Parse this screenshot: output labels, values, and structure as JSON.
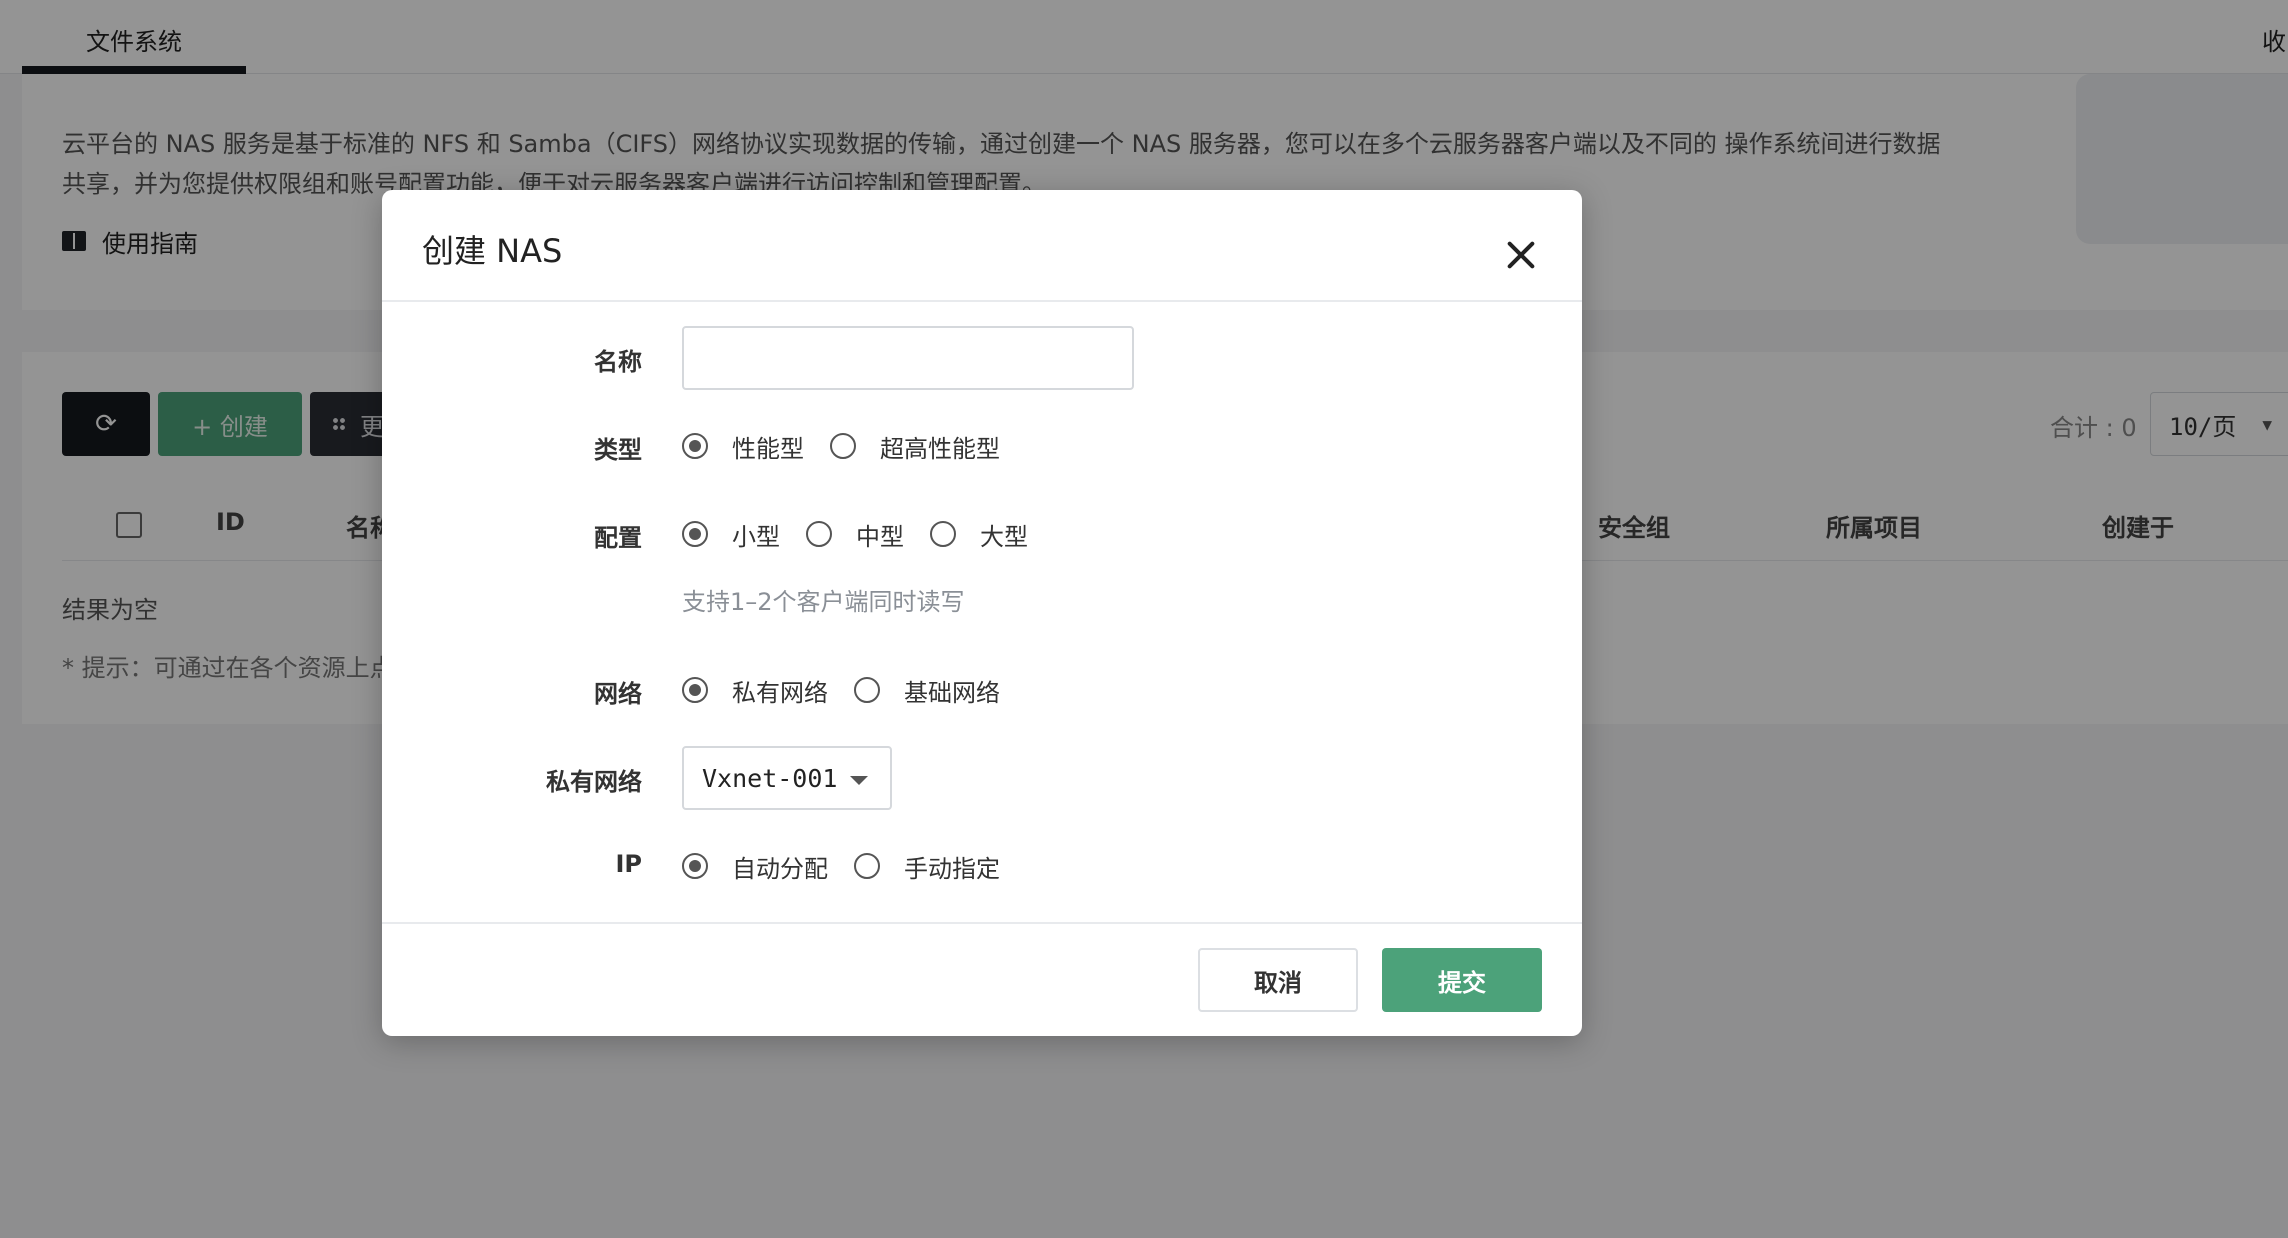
{
  "tabs": {
    "active_label": "文件系统",
    "collapse_label": "收"
  },
  "description": {
    "text": "云平台的 NAS 服务是基于标准的 NFS 和 Samba（CIFS）网络协议实现数据的传输，通过创建一个 NAS 服务器，您可以在多个云服务器客户端以及不同的 操作系统间进行数据共享，并为您提供权限组和账号配置功能，便于对云服务器客户端进行访问控制和管理配置。",
    "guide_label": "使用指南",
    "guide_icon": "book-icon"
  },
  "toolbar": {
    "refresh_icon": "refresh-icon",
    "create_label": "+ 创建",
    "more_label": "更",
    "total_label": "合计 : 0",
    "page_size": "10/页"
  },
  "table": {
    "headers": {
      "id": "ID",
      "name": "名称",
      "security_group": "安全组",
      "project": "所属项目",
      "created": "创建于"
    },
    "empty_text": "结果为空",
    "hint_text": "* 提示：可通过在各个资源上点"
  },
  "modal": {
    "title": "创建 NAS",
    "close_icon": "close-icon",
    "fields": {
      "name": {
        "label": "名称",
        "value": "",
        "placeholder": ""
      },
      "type": {
        "label": "类型",
        "options": [
          "性能型",
          "超高性能型"
        ],
        "selected": "性能型"
      },
      "config": {
        "label": "配置",
        "options": [
          "小型",
          "中型",
          "大型"
        ],
        "selected": "小型",
        "helper": "支持1–2个客户端同时读写"
      },
      "network": {
        "label": "网络",
        "options": [
          "私有网络",
          "基础网络"
        ],
        "selected": "私有网络"
      },
      "vxnet": {
        "label": "私有网络",
        "value": "Vxnet-001"
      },
      "ip": {
        "label": "IP",
        "options": [
          "自动分配",
          "手动指定"
        ],
        "selected": "自动分配"
      }
    },
    "buttons": {
      "cancel": "取消",
      "submit": "提交"
    }
  },
  "colors": {
    "primary": "#4ca27a",
    "dark": "#16191e",
    "mask": "rgba(0,0,0,0.42)"
  }
}
